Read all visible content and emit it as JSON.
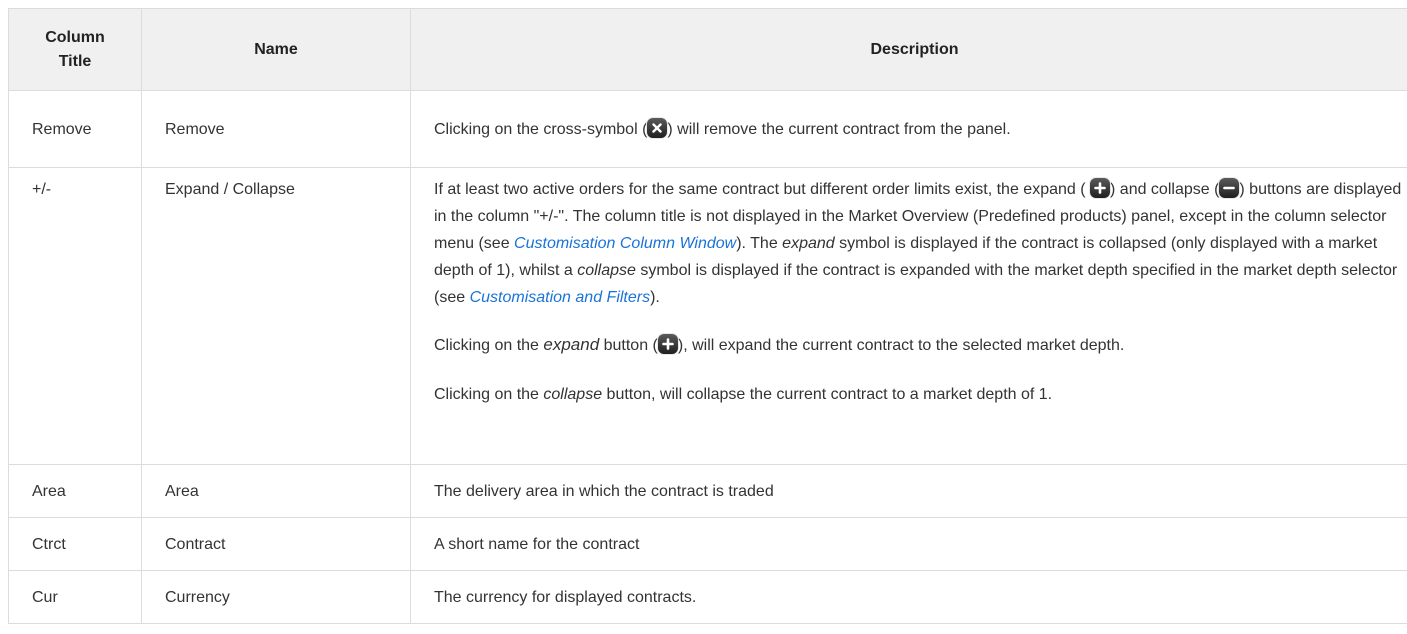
{
  "table": {
    "headers": {
      "column_title": "Column Title",
      "name": "Name",
      "description": "Description"
    },
    "rows": {
      "remove": {
        "title": "Remove",
        "name": "Remove",
        "desc_before": "Clicking on the cross-symbol (",
        "desc_icon": "cross-icon",
        "desc_after": ") will remove the current contract from the panel."
      },
      "expand": {
        "title": "+/-",
        "name": "Expand / Collapse",
        "p1_a": "If at least two active orders for the same contract but different order limits exist, the expand ( ",
        "p1_icon1": "plus-icon",
        "p1_b": ") and collapse (",
        "p1_icon2": "minus-icon",
        "p1_c": ") buttons are displayed in the column \"+/-\". The column title is not displayed in the Market Overview (Predefined products) panel, except in the column selector menu (see ",
        "p1_link1": "Customisation Column Window",
        "p1_d": "). The ",
        "p1_em1": "expand",
        "p1_e": " symbol is displayed if the contract is collapsed (only displayed with a market depth of 1), whilst a ",
        "p1_em2": "collapse",
        "p1_f": " symbol is displayed if the contract is expanded with the market depth specified in the market depth selector (see ",
        "p1_link2": "Customisation and Filters",
        "p1_g": ").",
        "p2_a": "Clicking on the ",
        "p2_em": "expand",
        "p2_b": " button (",
        "p2_icon": "plus-icon",
        "p2_c": "), will expand the current contract to the selected market depth.",
        "p3_a": "Clicking on the ",
        "p3_em": "collapse",
        "p3_b": " button, will collapse the current contract to a market depth of 1."
      },
      "area": {
        "title": "Area",
        "name": "Area",
        "description": "The delivery area in which the contract is traded"
      },
      "ctrct": {
        "title": "Ctrct",
        "name": "Contract",
        "description": "A short name for the contract"
      },
      "cur": {
        "title": "Cur",
        "name": "Currency",
        "description": "The currency for displayed contracts."
      }
    }
  },
  "colors": {
    "header_bg": "#f0f0f0",
    "border": "#dcdcdc",
    "link": "#1a73d9",
    "text": "#333333"
  }
}
